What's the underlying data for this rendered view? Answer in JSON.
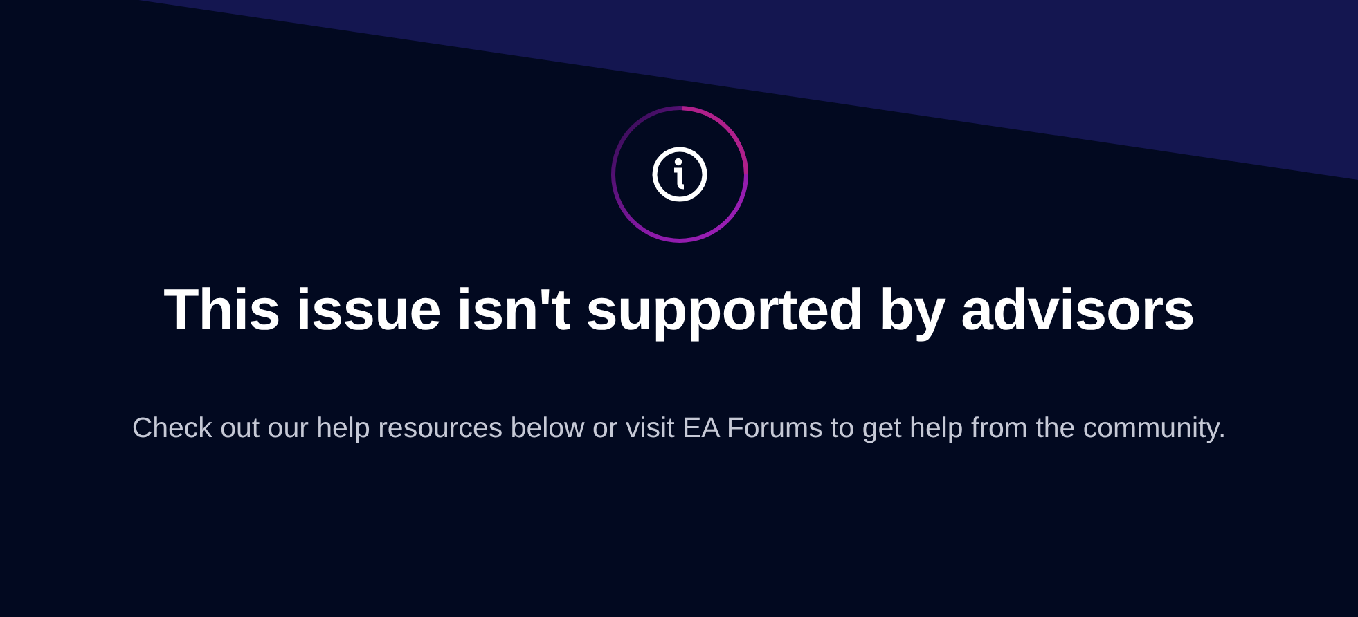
{
  "title": "This issue isn't supported by advisors",
  "message": "Check out our help resources below or visit EA Forums to get help from the community."
}
